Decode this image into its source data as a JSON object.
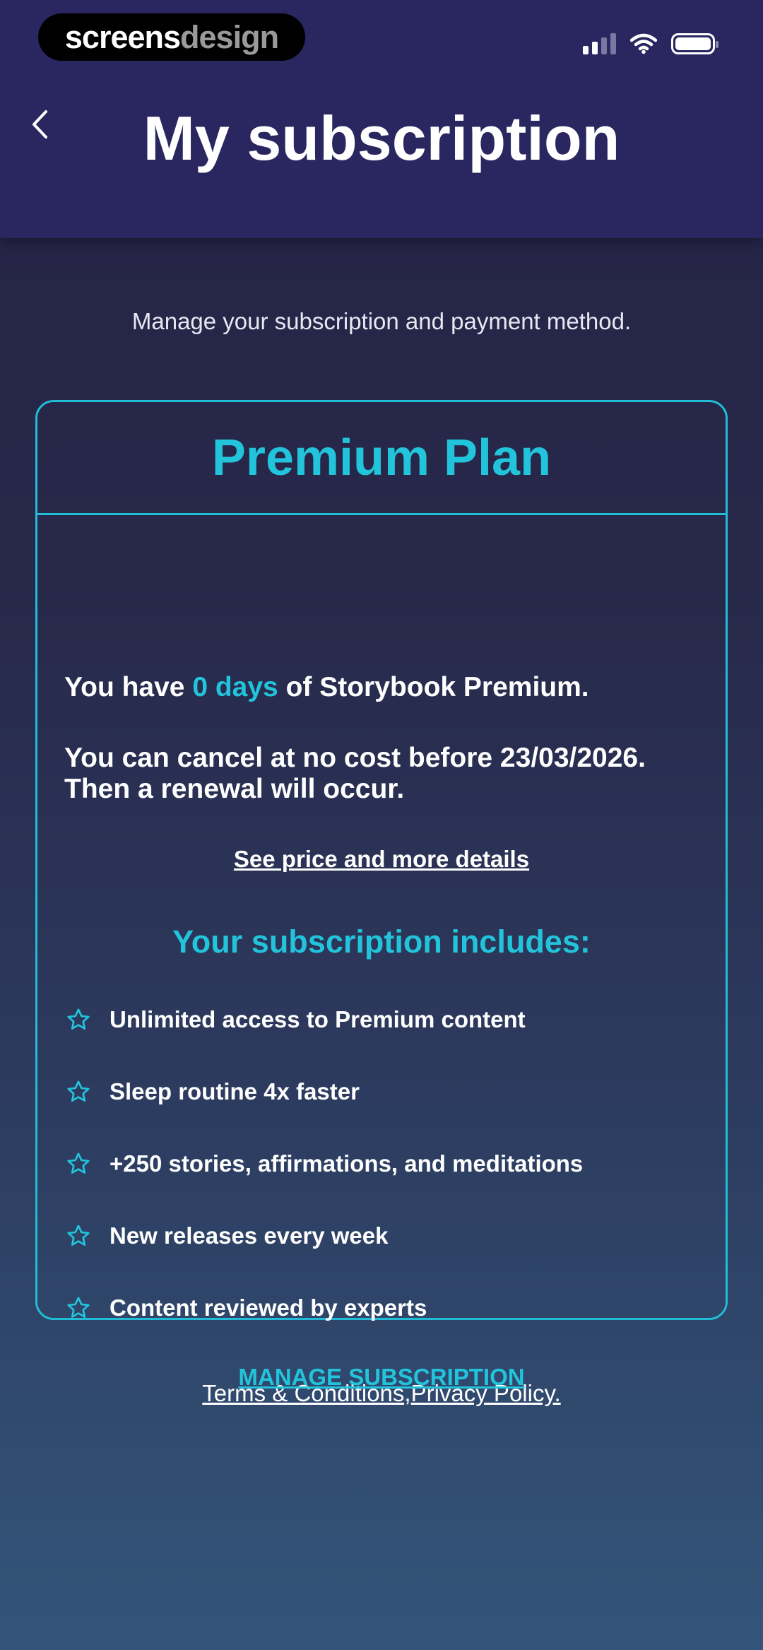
{
  "status_bar": {
    "brand_white": "screens",
    "brand_gray": "design",
    "icons": [
      "signal-icon",
      "wifi-icon",
      "battery-icon"
    ]
  },
  "header": {
    "back_icon": "chevron-left-icon",
    "title": "My subscription"
  },
  "subtitle": "Manage your subscription and payment method.",
  "plan": {
    "name": "Premium Plan",
    "days_prefix": "You have ",
    "days_value": "0 days",
    "days_suffix": " of Storybook Premium.",
    "cancel_line1": "You can cancel at no cost before 23/03/2026.",
    "cancel_line2": "Then a renewal will occur.",
    "details_link": "See price and more details",
    "includes_title": "Your subscription includes:",
    "features": [
      "Unlimited access to Premium content",
      "Sleep routine 4x faster",
      "+250 stories, affirmations, and meditations",
      "New releases every week",
      "Content reviewed by experts"
    ],
    "terms_link": "Terms & Conditions,",
    "privacy_link": "Privacy Policy."
  },
  "manage_button": "MANAGE SUBSCRIPTION",
  "colors": {
    "accent": "#22c4db",
    "header_bg": "#2a2660",
    "background_top": "#252347",
    "background_bottom": "#33557a"
  }
}
